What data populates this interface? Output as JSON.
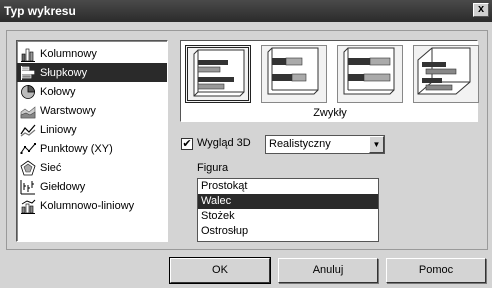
{
  "window": {
    "title": "Typ wykresu",
    "close_label": "x"
  },
  "chart_types": [
    {
      "label": "Kolumnowy",
      "icon": "column-chart-icon",
      "selected": false
    },
    {
      "label": "Słupkowy",
      "icon": "bar-chart-icon",
      "selected": true
    },
    {
      "label": "Kołowy",
      "icon": "pie-chart-icon",
      "selected": false
    },
    {
      "label": "Warstwowy",
      "icon": "area-chart-icon",
      "selected": false
    },
    {
      "label": "Liniowy",
      "icon": "line-chart-icon",
      "selected": false
    },
    {
      "label": "Punktowy (XY)",
      "icon": "scatter-chart-icon",
      "selected": false
    },
    {
      "label": "Sieć",
      "icon": "radar-chart-icon",
      "selected": false
    },
    {
      "label": "Giełdowy",
      "icon": "stock-chart-icon",
      "selected": false
    },
    {
      "label": "Kolumnowo-liniowy",
      "icon": "column-line-chart-icon",
      "selected": false
    }
  ],
  "subtypes": {
    "selected_name": "Zwykły"
  },
  "look3d": {
    "label": "Wygląd 3D",
    "checked": true,
    "value": "Realistyczny"
  },
  "figure": {
    "label": "Figura",
    "options": [
      "Prostokąt",
      "Walec",
      "Stożek",
      "Ostrosłup"
    ],
    "selected": "Walec"
  },
  "buttons": {
    "ok": "OK",
    "cancel": "Anuluj",
    "help": "Pomoc"
  }
}
